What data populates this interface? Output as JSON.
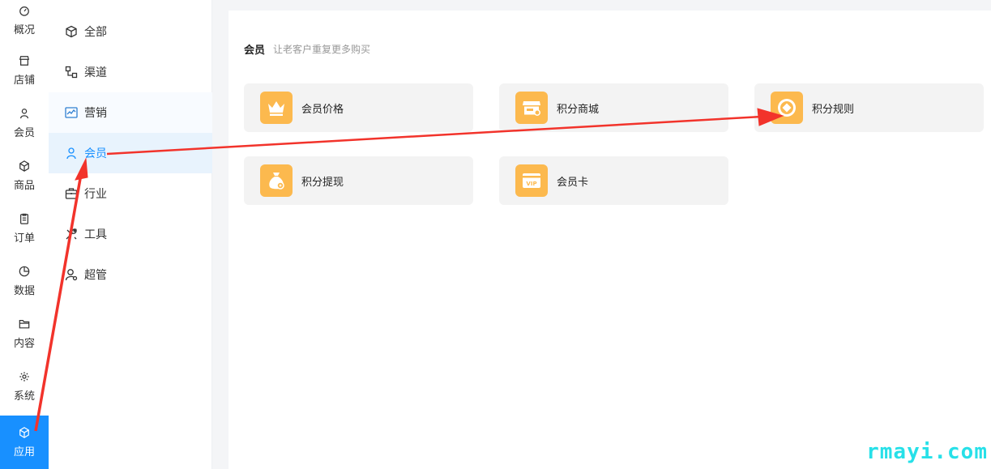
{
  "rail": {
    "items": [
      {
        "label": "概况",
        "icon": "dashboard-icon"
      },
      {
        "label": "店铺",
        "icon": "store-icon"
      },
      {
        "label": "会员",
        "icon": "user-icon"
      },
      {
        "label": "商品",
        "icon": "box-icon"
      },
      {
        "label": "订单",
        "icon": "clipboard-icon"
      },
      {
        "label": "数据",
        "icon": "pie-chart-icon"
      },
      {
        "label": "内容",
        "icon": "folder-icon"
      },
      {
        "label": "系统",
        "icon": "gear-icon"
      },
      {
        "label": "应用",
        "icon": "app-box-icon",
        "active": true
      }
    ]
  },
  "submenu": {
    "items": [
      {
        "label": "全部",
        "icon": "cube-icon"
      },
      {
        "label": "渠道",
        "icon": "channel-icon"
      },
      {
        "label": "营销",
        "icon": "trend-icon"
      },
      {
        "label": "会员",
        "icon": "user-icon",
        "active": true
      },
      {
        "label": "行业",
        "icon": "briefcase-icon"
      },
      {
        "label": "工具",
        "icon": "tools-icon"
      },
      {
        "label": "超管",
        "icon": "admin-icon"
      }
    ]
  },
  "section": {
    "title": "会员",
    "subtitle": "让老客户重复更多购买"
  },
  "cards": [
    {
      "label": "会员价格",
      "icon": "crown-icon"
    },
    {
      "label": "积分商城",
      "icon": "shop-icon"
    },
    {
      "label": "积分规则",
      "icon": "coin-icon"
    },
    {
      "label": "积分提现",
      "icon": "money-bag-icon"
    },
    {
      "label": "会员卡",
      "icon": "vip-card-icon"
    }
  ],
  "colors": {
    "accent": "#1890ff",
    "active_bg": "#e8f3fd",
    "card_icon_bg": "#fcb94e",
    "card_bg": "#f3f3f3",
    "annotation_arrow": "#f2332b",
    "watermark": "#27e0e8"
  },
  "watermark": "rmayi.com"
}
